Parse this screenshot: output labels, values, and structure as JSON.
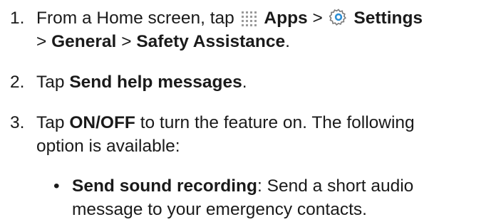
{
  "steps": [
    {
      "number": "1.",
      "line1_prefix": "From a Home screen, tap",
      "apps_icon": "apps-grid-icon",
      "apps_label": "Apps",
      "sep1": ">",
      "settings_icon": "settings-gear-icon",
      "settings_label": "Settings",
      "line2_prefix": ">",
      "general_label": "General",
      "sep2": ">",
      "safety_label": "Safety Assistance",
      "line2_suffix": "."
    },
    {
      "number": "2.",
      "prefix": "Tap",
      "bold": "Send help messages",
      "suffix": "."
    },
    {
      "number": "3.",
      "prefix": "Tap",
      "bold": "ON/OFF",
      "line1_suffix": "to turn the feature on. The following",
      "line2": "option is available:"
    }
  ],
  "bullet": {
    "symbol": "•",
    "bold": "Send sound recording",
    "line1_suffix": ": Send a short audio",
    "line2": "message to your emergency contacts."
  },
  "colors": {
    "text": "#1a1a1a",
    "icon_grey": "#9a9a9a",
    "settings_blue": "#2e8fd4"
  }
}
